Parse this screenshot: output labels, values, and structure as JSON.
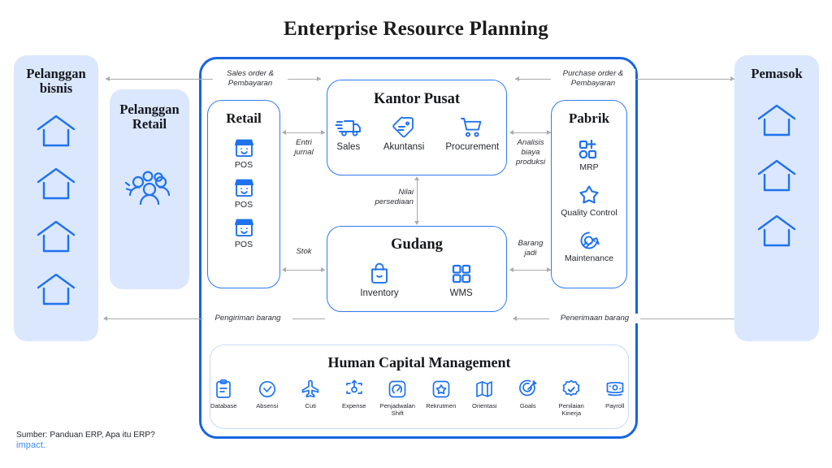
{
  "title": "Enterprise Resource Planning",
  "panels": {
    "business_customers": {
      "title": "Pelanggan\nbisnis",
      "label": "Pelanggan bisnis",
      "house_count": 4,
      "icon": "house-icon"
    },
    "retail_customers": {
      "title": "Pelanggan\nRetail",
      "label": "Pelanggan Retail",
      "icon": "crowd-people-icon"
    },
    "suppliers": {
      "title": "Pemasok",
      "label": "Pemasok",
      "house_count": 3,
      "icon": "house-icon"
    }
  },
  "boxes": {
    "retail": {
      "title": "Retail",
      "items": [
        {
          "label": "POS",
          "icon": "storefront-icon"
        },
        {
          "label": "POS",
          "icon": "storefront-icon"
        },
        {
          "label": "POS",
          "icon": "storefront-icon"
        }
      ]
    },
    "head_office": {
      "title": "Kantor Pusat",
      "items": [
        {
          "label": "Sales",
          "icon": "delivery-truck-icon"
        },
        {
          "label": "Akuntansi",
          "icon": "price-tag-icon"
        },
        {
          "label": "Procurement",
          "icon": "shopping-cart-icon"
        }
      ]
    },
    "warehouse": {
      "title": "Gudang",
      "items": [
        {
          "label": "Inventory",
          "icon": "shopping-bag-icon"
        },
        {
          "label": "WMS",
          "icon": "grid-squares-icon"
        }
      ]
    },
    "factory": {
      "title": "Pabrik",
      "items": [
        {
          "label": "MRP",
          "icon": "add-blocks-icon"
        },
        {
          "label": "Quality Control",
          "icon": "star-icon"
        },
        {
          "label": "Maintenance",
          "icon": "gear-wrench-icon"
        }
      ]
    },
    "hcm": {
      "title": "Human Capital Management",
      "items": [
        {
          "label": "Database",
          "icon": "clipboard-icon"
        },
        {
          "label": "Absensi",
          "icon": "clock-check-icon"
        },
        {
          "label": "Cuti",
          "icon": "airplane-icon"
        },
        {
          "label": "Expense",
          "icon": "expense-card-icon"
        },
        {
          "label": "Penjadwalan Shift",
          "icon": "speedometer-icon"
        },
        {
          "label": "Rekrutmen",
          "icon": "star-badge-icon"
        },
        {
          "label": "Orientasi",
          "icon": "map-icon"
        },
        {
          "label": "Goals",
          "icon": "target-icon"
        },
        {
          "label": "Penilaian Kinerja",
          "icon": "verified-check-icon"
        },
        {
          "label": "Payroll",
          "icon": "money-bill-icon"
        }
      ]
    }
  },
  "connectors": [
    {
      "id": "sales-order",
      "label": "Sales order &\nPembayaran",
      "direction": "bidirectional"
    },
    {
      "id": "purchase-order",
      "label": "Purchase order &\nPembayaran",
      "direction": "bidirectional"
    },
    {
      "id": "entri-jurnal",
      "label": "Entri\njurnal",
      "direction": "bidirectional"
    },
    {
      "id": "analisis-biaya",
      "label": "Analisis\nbiaya\nproduksi",
      "direction": "bidirectional"
    },
    {
      "id": "nilai-persediaan",
      "label": "Nilai\npersediaan",
      "direction": "bidirectional"
    },
    {
      "id": "stok",
      "label": "Stok",
      "direction": "bidirectional"
    },
    {
      "id": "barang-jadi",
      "label": "Barang\njadi",
      "direction": "bidirectional"
    },
    {
      "id": "pengiriman-barang",
      "label": "Pengiriman barang",
      "direction": "left"
    },
    {
      "id": "penerimaan-barang",
      "label": "Penerimaan barang",
      "direction": "left"
    }
  ],
  "connector_labels": {
    "sales_order_l1": "Sales order &",
    "sales_order_l2": "Pembayaran",
    "purchase_order_l1": "Purchase order &",
    "purchase_order_l2": "Pembayaran",
    "entri_l1": "Entri",
    "entri_l2": "jurnal",
    "analisis_l1": "Analisis",
    "analisis_l2": "biaya",
    "analisis_l3": "produksi",
    "nilai_l1": "Nilai",
    "nilai_l2": "persediaan",
    "stok": "Stok",
    "barang_l1": "Barang",
    "barang_l2": "jadi",
    "pengiriman": "Pengiriman barang",
    "penerimaan": "Penerimaan barang"
  },
  "footer": {
    "source": "Sumber: Panduan ERP, Apa itu ERP?",
    "brand": "impact."
  },
  "colors": {
    "accent_blue": "#1765e0",
    "icon_blue": "#2f7cf0",
    "panel_bg": "#dbe7fd",
    "connector_gray": "#a9abae",
    "text_dark": "#14171c"
  }
}
